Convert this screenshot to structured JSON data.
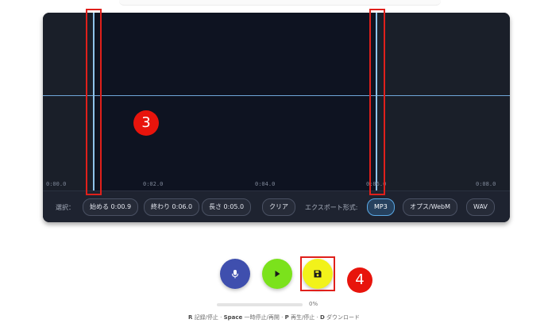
{
  "timeline": {
    "ticks": [
      "0:00.0",
      "0:02.0",
      "0:04.0",
      "0:06.0",
      "0:08.0"
    ]
  },
  "toolbar": {
    "selection_label": "選択：",
    "start_chip": "始める 0:00.9",
    "end_chip": "終わり 0:06.0",
    "length_chip": "長さ 0:05.0",
    "clear_button": "クリア",
    "export_label": "エクスポート形式:",
    "formats": [
      "MP3",
      "オプス/WebM",
      "WAV"
    ],
    "selected_format": "MP3"
  },
  "annotations": {
    "step3": "3",
    "step4": "4",
    "highlight_color": "#e0201b"
  },
  "recorder": {
    "icons": [
      "microphone-icon",
      "play-icon",
      "save-icon"
    ],
    "progress_value": 0,
    "progress_text": "0%"
  },
  "shortcuts": [
    {
      "key": "R",
      "action": "記録/停止"
    },
    {
      "key": "Space",
      "action": "一時停止/再開"
    },
    {
      "key": "P",
      "action": "再生/停止"
    },
    {
      "key": "D",
      "action": "ダウンロード"
    }
  ],
  "colors": {
    "editor_bg": "#1b1f2a",
    "selection_bg": "#0e1321",
    "marker": "#8fc3ea",
    "mic_button": "#3f4fae",
    "play_button": "#7be21c",
    "save_button": "#f2f21a",
    "badge": "#e8140c"
  }
}
